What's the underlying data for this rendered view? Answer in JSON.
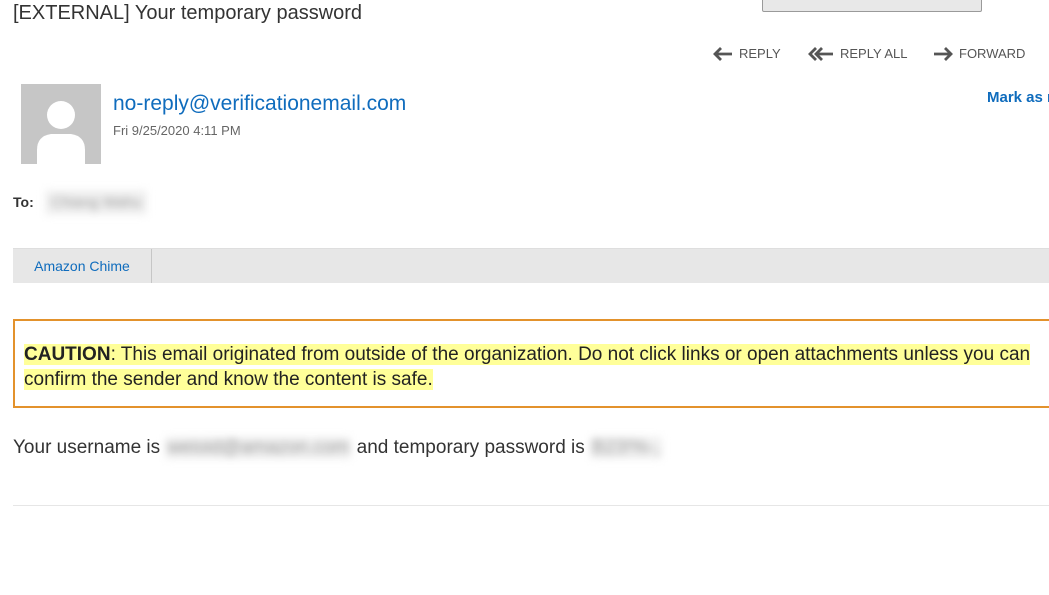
{
  "email": {
    "subject": "[EXTERNAL] Your temporary password",
    "actions": {
      "reply": "REPLY",
      "reply_all": "REPLY ALL",
      "forward": "FORWARD"
    },
    "sender": {
      "address": "no-reply@verificationemail.com",
      "date": "Fri 9/25/2020 4:11 PM",
      "avatar_icon": "person-icon"
    },
    "mark_as_read": "Mark as r",
    "to": {
      "label": "To:",
      "recipient": "Chiang Wahu"
    },
    "info_bar": {
      "tab": "Amazon Chime"
    },
    "caution": {
      "label": "CAUTION",
      "text": ": This email originated from outside of the organization. Do not click links or open attachments unless you can confirm the sender and know the content is safe.",
      "border_color": "#e3922c",
      "highlight_color": "#ffff99"
    },
    "body": {
      "prefix": "Your username is",
      "username": "weioid@amazon.com",
      "middle": "and temporary password is",
      "password": "B23!%-,"
    }
  }
}
